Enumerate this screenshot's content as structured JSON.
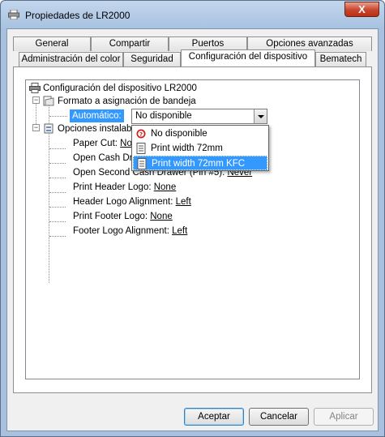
{
  "window": {
    "title": "Propiedades de LR2000",
    "close_glyph": "X"
  },
  "tabs_row1": [
    "General",
    "Compartir",
    "Puertos",
    "Opciones avanzadas"
  ],
  "tabs_row2": [
    "Administración del color",
    "Seguridad",
    "Configuración del dispositivo",
    "Bematech"
  ],
  "tree": {
    "root": "Configuración del dispositivo LR2000",
    "tray": "Formato a asignación de bandeja",
    "auto_label": "Automático:",
    "auto_value": "No disponible",
    "options_root": "Opciones instalab",
    "items": [
      {
        "label": "Paper Cut: ",
        "value": "No"
      },
      {
        "label": "Open Cash Dr",
        "value": ""
      },
      {
        "label": "Open Second Cash Drawer (Pin #5): ",
        "value": "Never"
      },
      {
        "label": "Print Header Logo: ",
        "value": "None"
      },
      {
        "label": "Header Logo Alignment: ",
        "value": "Left"
      },
      {
        "label": "Print Footer Logo: ",
        "value": "None"
      },
      {
        "label": "Footer Logo Alignment: ",
        "value": "Left"
      }
    ]
  },
  "dropdown": [
    "No disponible",
    "Print width 72mm",
    "Print width 72mm KFC"
  ],
  "buttons": {
    "ok": "Aceptar",
    "cancel": "Cancelar",
    "apply": "Aplicar"
  }
}
